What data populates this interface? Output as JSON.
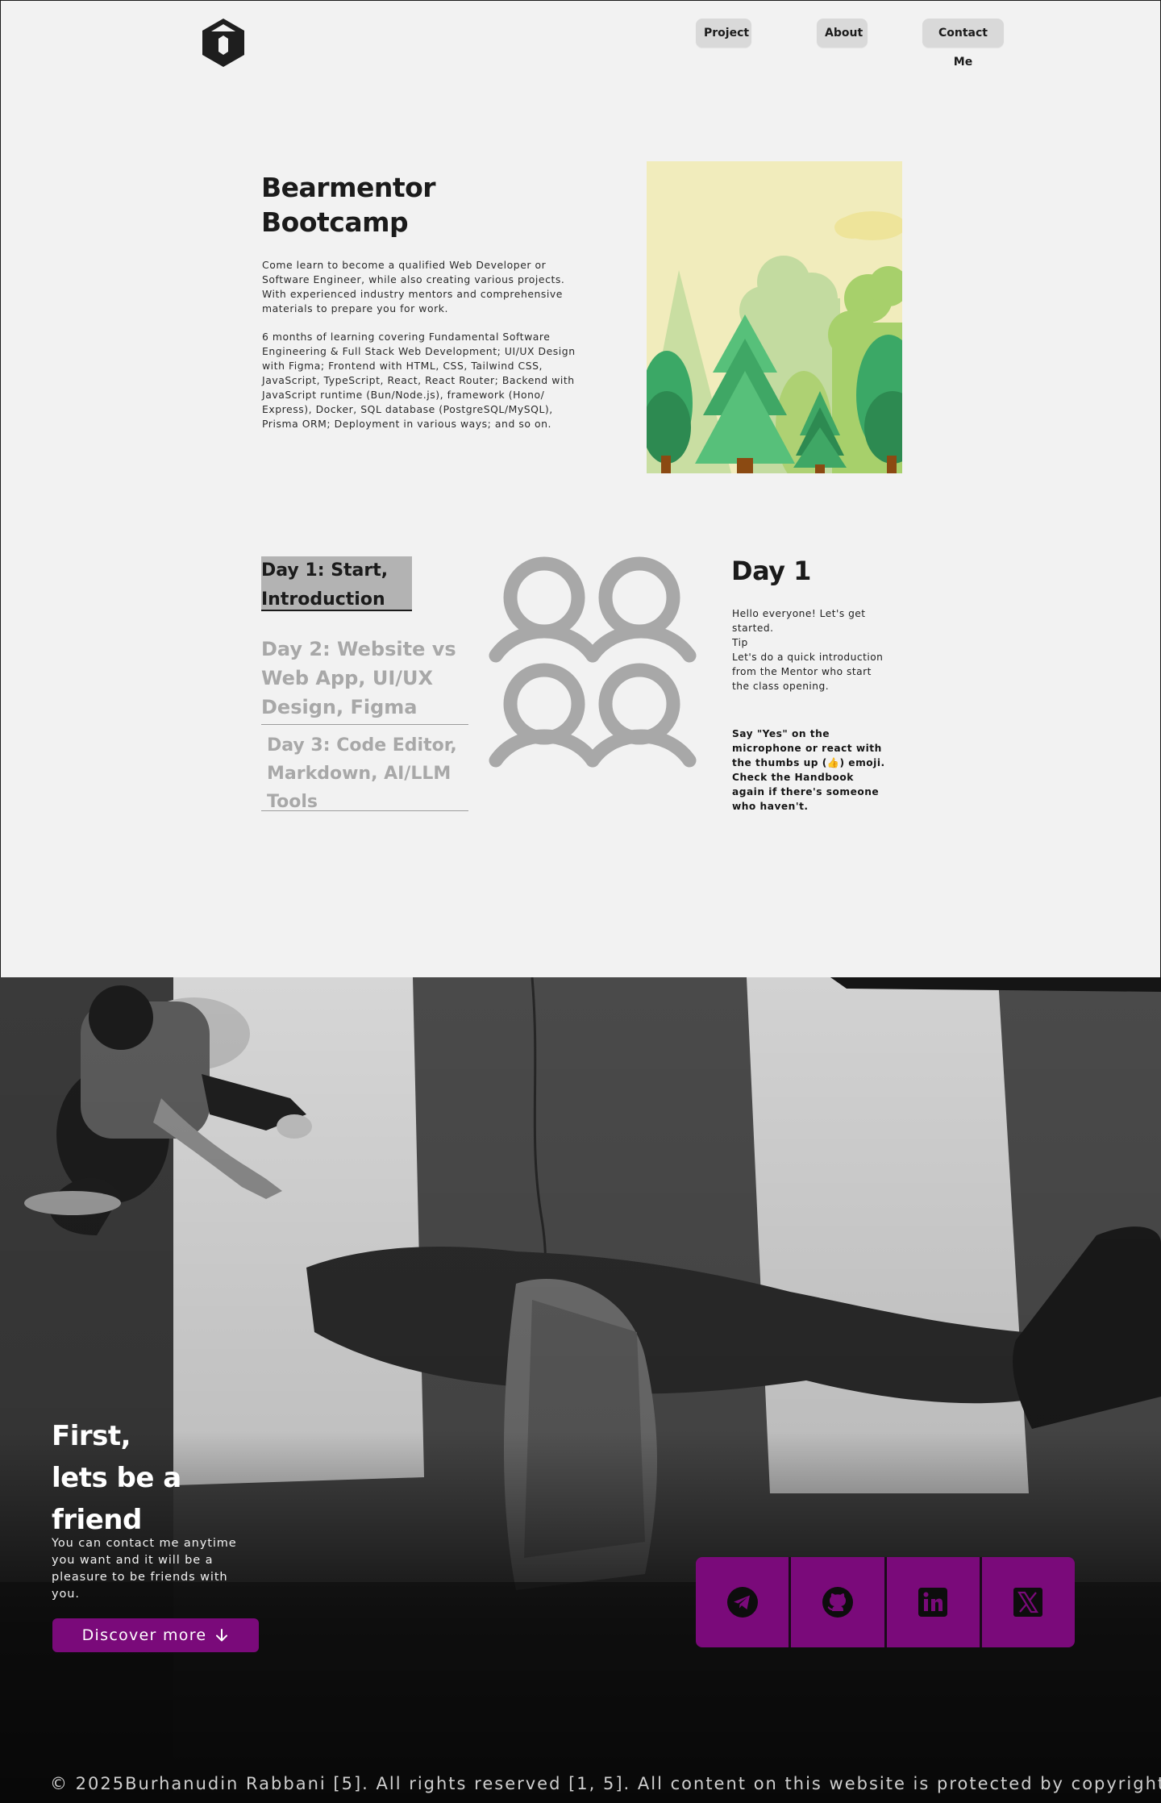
{
  "header": {
    "logo_icon": "hexagon-logo-icon",
    "nav": [
      {
        "label": "Project"
      },
      {
        "label": "About"
      },
      {
        "label": "Contact Me"
      }
    ]
  },
  "hero": {
    "title_line1": "Bearmentor",
    "title_line2": "Bootcamp",
    "paragraph1": "Come learn to become a qualified Web Developer or Software Engineer, while also creating various projects. With experienced industry mentors and comprehensive materials to prepare you for work.",
    "paragraph2": "6 months of learning covering Fundamental Software Engineering & Full Stack Web Development; UI/UX Design with Figma; Frontend with HTML, CSS, Tailwind CSS, JavaScript, TypeScript, React, React Router; Backend with JavaScript runtime (Bun/Node.js), framework (Hono/ Express), Docker, SQL database (PostgreSQL/MySQL), Prisma ORM; Deployment in various ways; and so on.",
    "illustration": "forest-illustration"
  },
  "days": [
    {
      "label": "Day 1:  Start, Introduction",
      "active": true
    },
    {
      "label": "Day 2: Website vs Web App, UI/UX Design, Figma",
      "active": false
    },
    {
      "label_lines": [
        "Day 3: Code Editor,",
        "Markdown, AI/LLM",
        "Tools"
      ],
      "active": false
    }
  ],
  "detail": {
    "icon": "users-group-icon",
    "title": "Day 1",
    "lines": [
      "Hello everyone! Let's get started.",
      "Tip",
      "Let's do a quick introduction from the Mentor who start the class opening."
    ],
    "bold": "Say \"Yes\" on the microphone or react with the thumbs up (👍) emoji. Check the Handbook again if there's someone who haven't."
  },
  "cta": {
    "title_lines": [
      "First,",
      "lets be a",
      "friend"
    ],
    "text": "You can contact me anytime you want and it will be a pleasure to be friends with you.",
    "button_label": "Discover more",
    "button_icon": "arrow-down-icon"
  },
  "social": [
    {
      "name": "telegram",
      "icon": "telegram-icon"
    },
    {
      "name": "github",
      "icon": "github-icon"
    },
    {
      "name": "linkedin",
      "icon": "linkedin-icon"
    },
    {
      "name": "x",
      "icon": "x-icon"
    }
  ],
  "colors": {
    "background": "#f2f2f2",
    "accent": "#7a0a7a",
    "active_tab": "#b3b3b3",
    "inactive_text": "#a8a8a8"
  },
  "footer": {
    "text": "© 2025Burhanudin Rabbani [5]. All rights reserved [1, 5]. All content on this website is protected by copyright law."
  }
}
